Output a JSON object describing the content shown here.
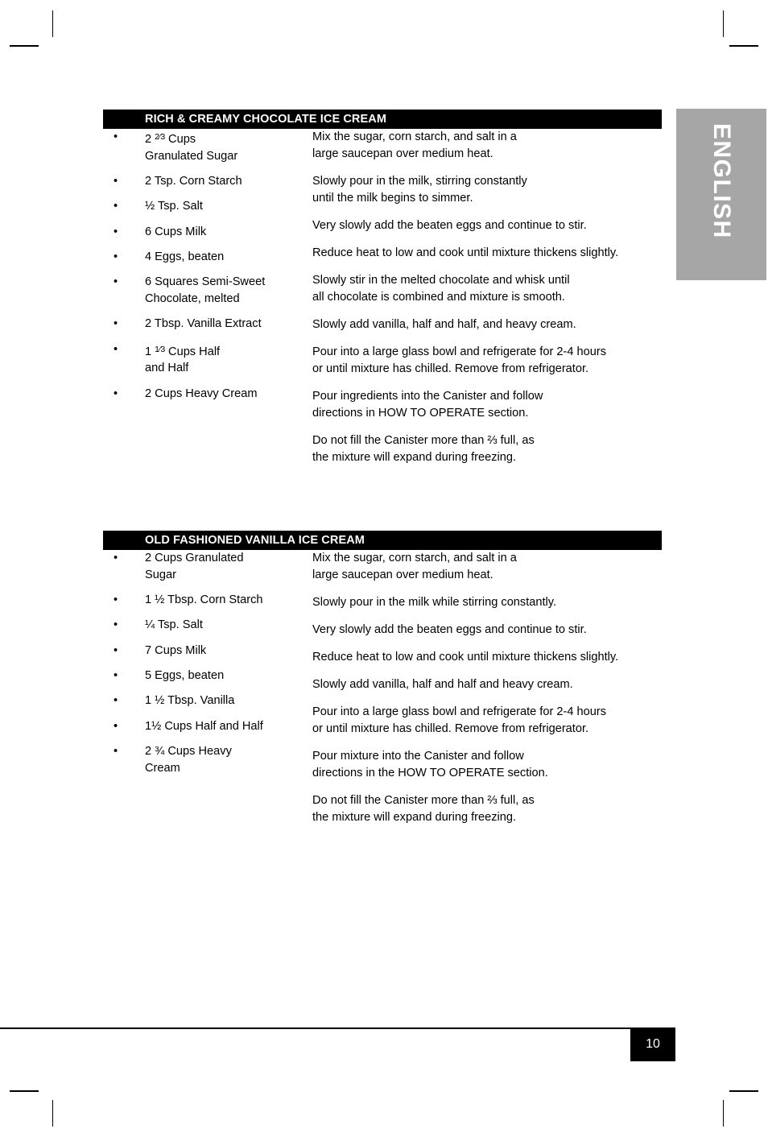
{
  "page": {
    "language_tab": "ENGLISH",
    "page_number": "10",
    "accent_black": "#000000",
    "tab_gray": "#a6a6a6"
  },
  "recipes": [
    {
      "title": "RICH & CREAMY CHOCOLATE ICE CREAM",
      "ingredients": [
        "2 <sup>2</sup>⁄<sub>3</sub> Cups\nGranulated Sugar",
        "2 Tsp. Corn Starch",
        "½ Tsp. Salt",
        "6 Cups Milk",
        "4 Eggs, beaten",
        "6 Squares Semi-Sweet\nChocolate, melted",
        "2 Tbsp. Vanilla Extract",
        "1 <sup>1</sup>⁄<sub>3</sub> Cups Half\nand Half",
        "2 Cups Heavy Cream"
      ],
      "steps": [
        "Mix the sugar, corn starch, and salt in a\nlarge saucepan over medium heat.",
        "Slowly pour in the milk, stirring constantly\nuntil the milk begins to simmer.",
        "Very slowly add the beaten eggs and continue to stir.",
        "Reduce heat to low and cook until mixture thickens slightly.",
        "Slowly stir in the melted chocolate and whisk until\nall chocolate is combined and mixture is smooth.",
        "Slowly add vanilla, half and half, and heavy cream.",
        "Pour into a large glass bowl and refrigerate for 2-4 hours\nor until mixture has chilled. Remove from refrigerator.",
        "Pour ingredients into the Canister and follow\ndirections in HOW TO OPERATE section.",
        "Do not fill the Canister more than ⅔ full, as\nthe mixture will expand during freezing."
      ]
    },
    {
      "title": "OLD FASHIONED VANILLA ICE CREAM",
      "ingredients": [
        "2 Cups Granulated\nSugar",
        "1 ½ Tbsp. Corn Starch",
        "¼ Tsp. Salt",
        "7 Cups Milk",
        "5 Eggs, beaten",
        "1 ½ Tbsp. Vanilla",
        "1½ Cups Half and Half",
        "2 ¾ Cups Heavy\nCream"
      ],
      "steps": [
        "Mix the sugar, corn starch, and salt in a\nlarge saucepan over medium heat.",
        "Slowly pour in the milk while stirring constantly.",
        "Very slowly add the beaten eggs and continue to stir.",
        "Reduce heat to low and cook until mixture thickens slightly.",
        "Slowly add vanilla, half and half and heavy cream.",
        "Pour into a large glass bowl and refrigerate for 2-4 hours\nor until mixture has chilled. Remove from refrigerator.",
        "Pour mixture into the Canister and follow\ndirections in the HOW TO OPERATE section.",
        "Do not fill the Canister more than ⅔ full, as\nthe mixture will expand during freezing."
      ]
    }
  ],
  "bullet_glyph": "•"
}
